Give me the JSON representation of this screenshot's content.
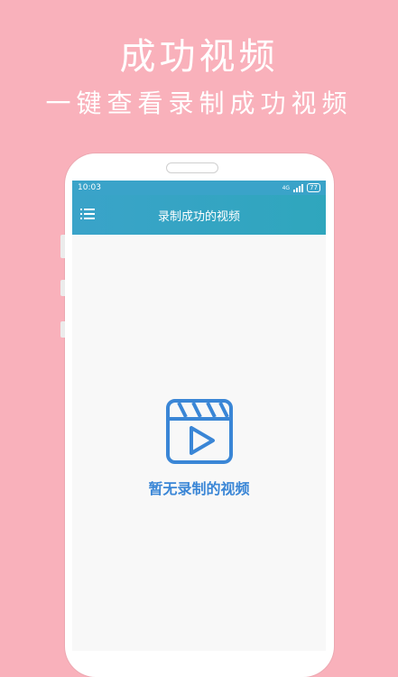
{
  "promo": {
    "headline": "成功视频",
    "subline": "一键查看录制成功视频"
  },
  "status_bar": {
    "time": "10:03",
    "network": "4G",
    "battery": "77"
  },
  "app_bar": {
    "title": "录制成功的视频",
    "menu_icon": "menu-list-icon"
  },
  "empty_state": {
    "icon": "video-clapperboard-play-icon",
    "message": "暂无录制的视频"
  },
  "colors": {
    "background": "#f9b1bb",
    "app_bar": "#3aa3c9",
    "accent": "#3a86d6"
  }
}
